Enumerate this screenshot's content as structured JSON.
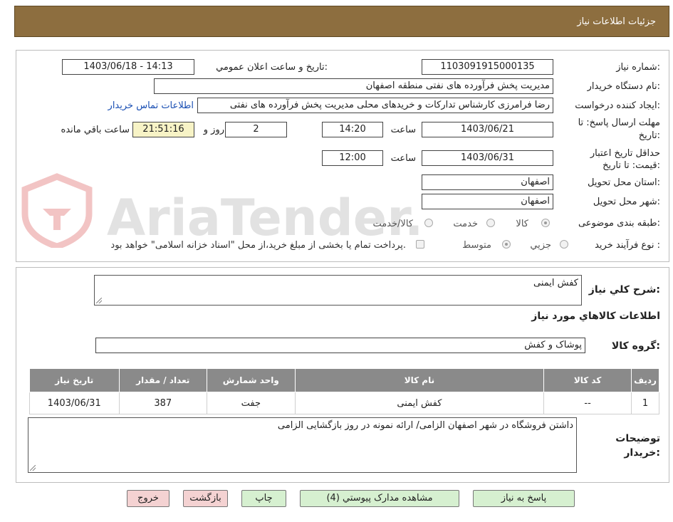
{
  "page_title": "جزئیات اطلاعات نیاز",
  "need_info": {
    "need_number_label": "شماره نیاز:",
    "need_number": "1103091915000135",
    "announce_label": "تاریخ و ساعت اعلان عمومي:",
    "announce_value": "1403/06/18 - 14:13",
    "buyer_org_label": "نام دستگاه خريدار:",
    "buyer_org": "مدیریت پخش فرآورده های نفتی منطقه اصفهان",
    "requester_label": "ايجاد کننده درخواست:",
    "requester": "رضا فرامرزی کارشناس تدارکات و خریدهای محلی مدیریت پخش فرآورده های نفتی",
    "contact_link": "اطلاعات تماس خریدار",
    "reply_deadline_label": "مهلت ارسال پاسخ: تا تاریخ:",
    "reply_date": "1403/06/21",
    "time_label": "ساعت",
    "reply_time": "14:20",
    "days_value": "2",
    "days_label": "روز و",
    "remaining_time": "21:51:16",
    "remaining_label": "ساعت باقي مانده",
    "price_validity_label": "حداقل تاریخ اعتبار قیمت: تا تاریخ:",
    "price_date": "1403/06/31",
    "price_time": "12:00",
    "province_label": "استان محل تحويل:",
    "province": "اصفهان",
    "city_label": "شهر محل تحويل:",
    "city": "اصفهان",
    "category_label": "طبقه بندی موضوعی:",
    "category_options": [
      "کالا",
      "خدمت",
      "کالا/خدمت"
    ],
    "category_selected": "کالا",
    "purchase_type_label": "نوع فرآیند خرید :",
    "purchase_options": [
      "جزيي",
      "متوسط"
    ],
    "purchase_selected": "متوسط",
    "payment_note": "پرداخت تمام یا بخشی از مبلغ خرید،از محل \"اسناد خزانه اسلامی\" خواهد بود."
  },
  "summary": {
    "description_label": "شرح کلي نياز:",
    "description": "کفش ایمنی",
    "goods_info_title": "اطلاعات کالاهاي مورد نياز",
    "goods_group_label": "گروه کالا:",
    "goods_group": "پوشاک و کفش"
  },
  "table": {
    "headers": [
      "رديف",
      "کد کالا",
      "نام کالا",
      "واحد شمارش",
      "تعداد / مقدار",
      "تاريخ نياز"
    ],
    "rows": [
      [
        "1",
        "--",
        "کفش ایمنی",
        "جفت",
        "387",
        "1403/06/31"
      ]
    ]
  },
  "buyer_notes": {
    "label": "توضيحات خريدار:",
    "text": "داشتن فروشگاه در شهر اصفهان الزامی/ ارائه نمونه در روز بازگشایی الزامی"
  },
  "buttons": {
    "reply": "پاسخ به نياز",
    "attachments": "مشاهده مدارک پيوستي (4)",
    "print": "چاپ",
    "back": "بازگشت",
    "exit": "خروج"
  },
  "watermark": {
    "text": "AriaTender.net"
  },
  "colors": {
    "header_bg": "#8d6e3f",
    "table_header_bg": "#8a8a8a",
    "button_green": "#d6f0d0",
    "button_pink": "#f4d2d2",
    "remaining_bg": "#f7f3c6"
  }
}
